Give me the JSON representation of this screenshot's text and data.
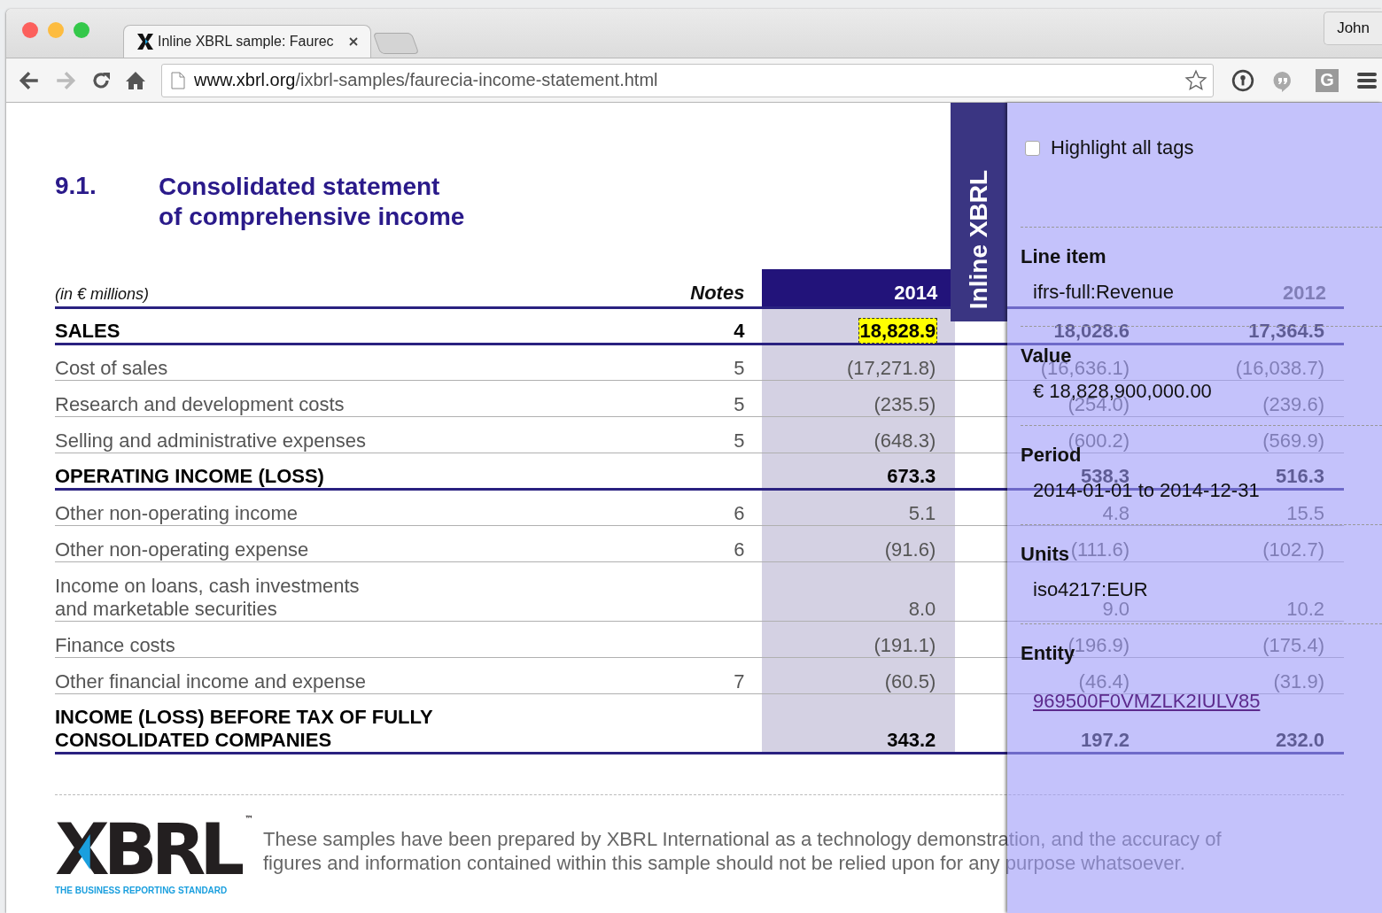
{
  "browser": {
    "tab_title": "Inline XBRL sample: Faurec",
    "profile": "John",
    "url_host": "www.xbrl.org",
    "url_path": "/ixbrl-samples/faurecia-income-statement.html",
    "extension_letter": "G"
  },
  "heading": {
    "number": "9.1.",
    "title_lines": [
      "Consolidated statement",
      "of comprehensive income"
    ]
  },
  "table": {
    "caption": "(in € millions)",
    "header": {
      "notes": "Notes",
      "current_year": "2014",
      "earlier_year": "2012"
    },
    "rows": [
      {
        "kind": "total",
        "label": [
          "SALES"
        ],
        "note": "4",
        "values": [
          "18,828.9",
          "18,028.6",
          "17,364.5"
        ],
        "selected": true
      },
      {
        "kind": "line",
        "label": [
          "Cost of sales"
        ],
        "note": "5",
        "values": [
          "(17,271.8)",
          "(16,636.1)",
          "(16,038.7)"
        ],
        "selected": false
      },
      {
        "kind": "line",
        "label": [
          "Research and development costs"
        ],
        "note": "5",
        "values": [
          "(235.5)",
          "(254.0)",
          "(239.6)"
        ],
        "selected": false
      },
      {
        "kind": "line",
        "label": [
          "Selling and administrative expenses"
        ],
        "note": "5",
        "values": [
          "(648.3)",
          "(600.2)",
          "(569.9)"
        ],
        "selected": false
      },
      {
        "kind": "total",
        "label": [
          "OPERATING INCOME (LOSS)"
        ],
        "values": [
          "673.3",
          "538.3",
          "516.3"
        ],
        "selected": false
      },
      {
        "kind": "line",
        "label": [
          "Other non-operating income"
        ],
        "note": "6",
        "values": [
          "5.1",
          "4.8",
          "15.5"
        ],
        "selected": false
      },
      {
        "kind": "line",
        "label": [
          "Other non-operating expense"
        ],
        "note": "6",
        "values": [
          "(91.6)",
          "(111.6)",
          "(102.7)"
        ],
        "selected": false
      },
      {
        "kind": "line",
        "label": [
          "Income on loans, cash investments",
          "and marketable securities"
        ],
        "values": [
          "8.0",
          "9.0",
          "10.2"
        ],
        "selected": false
      },
      {
        "kind": "line",
        "label": [
          "Finance costs"
        ],
        "values": [
          "(191.1)",
          "(196.9)",
          "(175.4)"
        ],
        "selected": false
      },
      {
        "kind": "line",
        "label": [
          "Other financial income and expense"
        ],
        "note": "7",
        "values": [
          "(60.5)",
          "(46.4)",
          "(31.9)"
        ],
        "selected": false
      },
      {
        "kind": "total",
        "label": [
          "INCOME (LOSS) BEFORE TAX OF FULLY",
          "CONSOLIDATED COMPANIES"
        ],
        "values": [
          "343.2",
          "197.2",
          "232.0"
        ],
        "selected": false
      }
    ]
  },
  "footer": {
    "logo": "XBRL",
    "trademark": "™",
    "tagline": "THE BUSINESS REPORTING STANDARD",
    "disclaimer_lines": [
      "These samples have been prepared by XBRL International as a technology demonstration, and the accuracy of",
      "figures and information contained within this sample should not be relied upon for any purpose whatsoever."
    ]
  },
  "panel": {
    "tab_label": "Inline XBRL",
    "highlight_all": {
      "label": "Highlight all tags",
      "checked": false
    },
    "fields": [
      {
        "kind": "text",
        "title": "Line item",
        "value": "ifrs-full:Revenue"
      },
      {
        "kind": "text",
        "title": "Value",
        "value": "€ 18,828,900,000.00"
      },
      {
        "kind": "text",
        "title": "Period",
        "value": "2014-01-01 to 2014-12-31"
      },
      {
        "kind": "text",
        "title": "Units",
        "value": "iso4217:EUR"
      },
      {
        "kind": "link",
        "title": "Entity",
        "value": "969500F0VMZLK2IULV85"
      }
    ]
  }
}
